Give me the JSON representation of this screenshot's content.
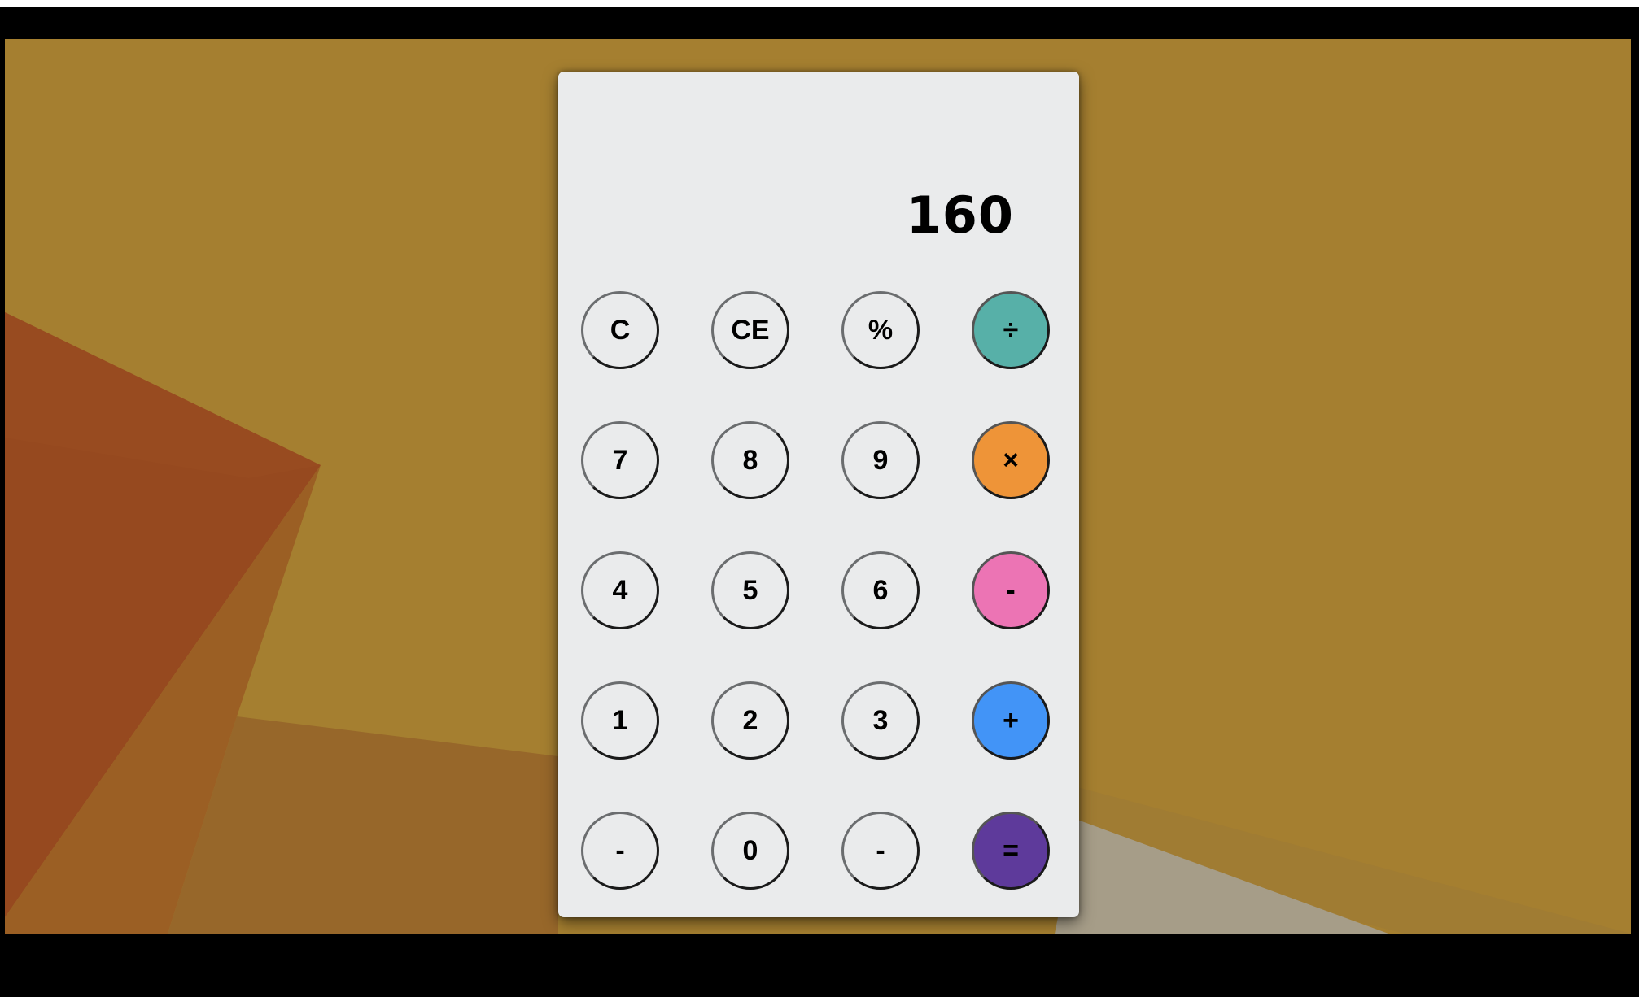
{
  "colors": {
    "background": "#a57f30",
    "panel": "#eaebec",
    "divide": "#57b0a8",
    "multiply": "#ee9438",
    "subtract": "#ec74b4",
    "add": "#4294f7",
    "equals": "#5e3a9b"
  },
  "display": {
    "value": "160"
  },
  "keys": [
    {
      "id": "clear",
      "label": "C",
      "color": ""
    },
    {
      "id": "clear-entry",
      "label": "CE",
      "color": ""
    },
    {
      "id": "percent",
      "label": "%",
      "color": ""
    },
    {
      "id": "divide",
      "label": "÷",
      "color": "#57b0a8"
    },
    {
      "id": "seven",
      "label": "7",
      "color": ""
    },
    {
      "id": "eight",
      "label": "8",
      "color": ""
    },
    {
      "id": "nine",
      "label": "9",
      "color": ""
    },
    {
      "id": "multiply",
      "label": "×",
      "color": "#ee9438"
    },
    {
      "id": "four",
      "label": "4",
      "color": ""
    },
    {
      "id": "five",
      "label": "5",
      "color": ""
    },
    {
      "id": "six",
      "label": "6",
      "color": ""
    },
    {
      "id": "subtract",
      "label": "-",
      "color": "#ec74b4"
    },
    {
      "id": "one",
      "label": "1",
      "color": ""
    },
    {
      "id": "two",
      "label": "2",
      "color": ""
    },
    {
      "id": "three",
      "label": "3",
      "color": ""
    },
    {
      "id": "add",
      "label": "+",
      "color": "#4294f7"
    },
    {
      "id": "negate",
      "label": "-",
      "color": ""
    },
    {
      "id": "zero",
      "label": "0",
      "color": ""
    },
    {
      "id": "decimal",
      "label": "-",
      "color": ""
    },
    {
      "id": "equals",
      "label": "=",
      "color": "#5e3a9b"
    }
  ]
}
